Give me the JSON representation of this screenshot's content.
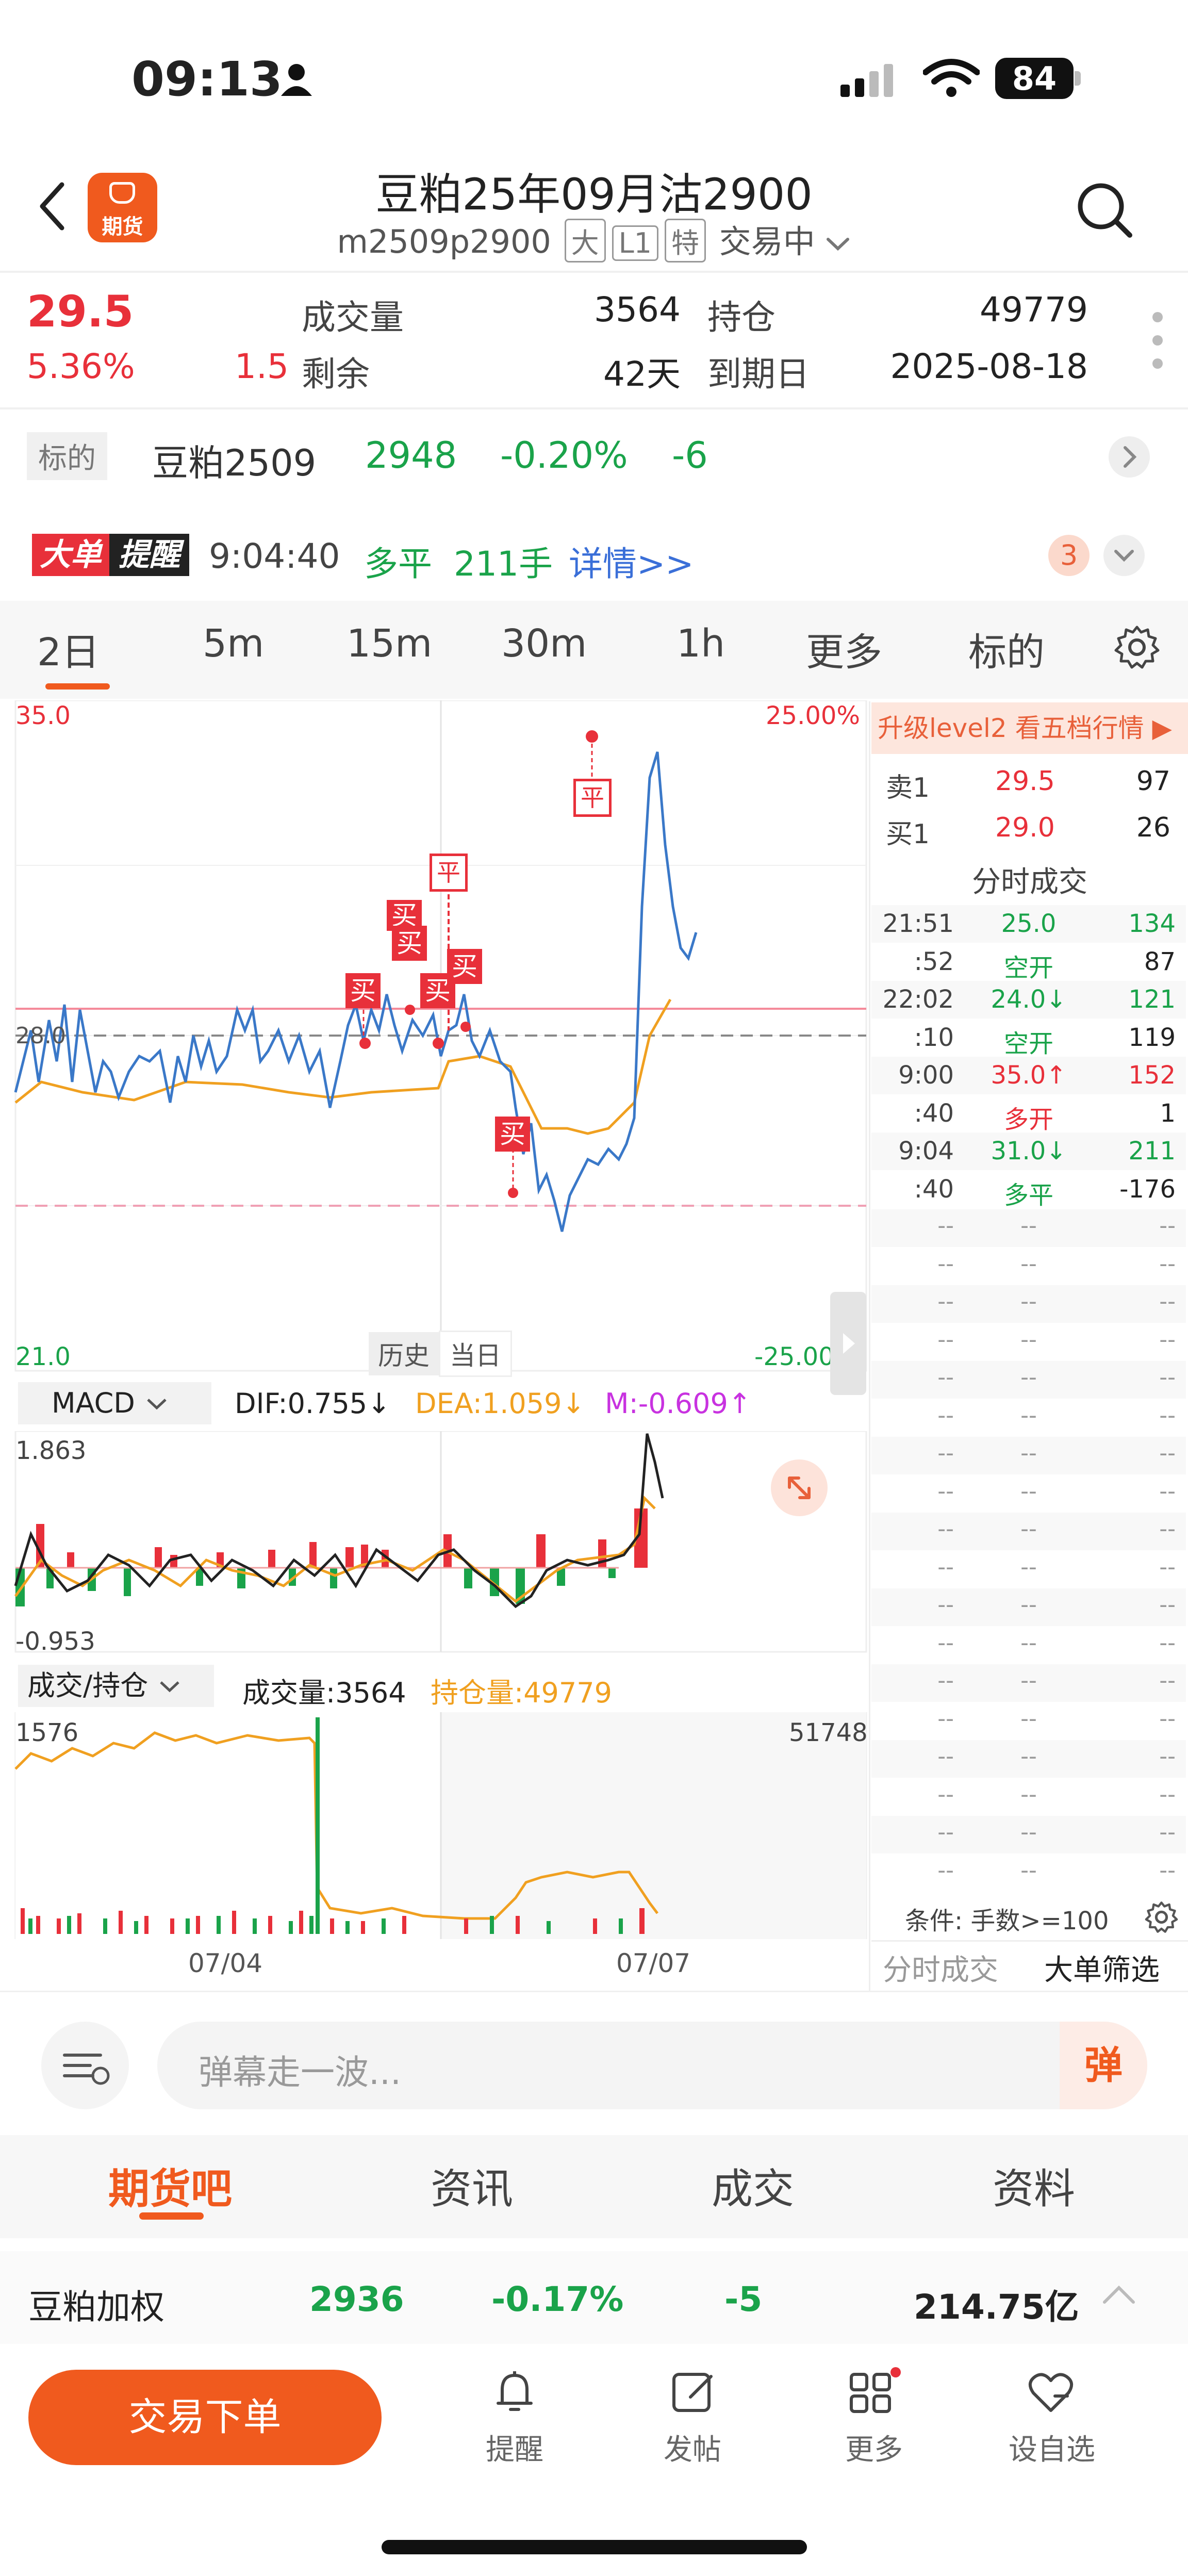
{
  "status": {
    "time": "09:13",
    "battery": "84"
  },
  "header": {
    "title": "豆粕25年09月沽2900",
    "logo_text": "期货",
    "contract": "m2509p2900",
    "tags": [
      "大",
      "L1",
      "特"
    ],
    "trading_status": "交易中"
  },
  "quote": {
    "price": "29.5",
    "change_pct": "5.36%",
    "change": "1.5",
    "volume_label": "成交量",
    "volume": "3564",
    "oi_label": "持仓",
    "oi": "49779",
    "remain_label": "剩余",
    "remain": "42天",
    "expiry_label": "到期日",
    "expiry": "2025-08-18"
  },
  "underlying": {
    "tag": "标的",
    "name": "豆粕2509",
    "price": "2948",
    "pct": "-0.20%",
    "chg": "-6"
  },
  "alert": {
    "badge1": "大单",
    "badge2": "提醒",
    "time": "9:04:40",
    "type": "多平",
    "size": "211手",
    "detail": "详情>>",
    "count": "3"
  },
  "chart_tabs": [
    "2日",
    "5m",
    "15m",
    "30m",
    "1h",
    "更多",
    "标的"
  ],
  "main_chart": {
    "y_top": "35.0",
    "y_bottom": "21.0",
    "y_mid": "28.0",
    "pct_top": "25.00%",
    "pct_bottom": "-25.00%",
    "history_btn": "历史",
    "today_btn": "当日",
    "markers": [
      "买",
      "买",
      "买",
      "买",
      "买",
      "平",
      "买",
      "平"
    ]
  },
  "macd": {
    "selector": "MACD",
    "dif": "DIF:0.755↓",
    "dea": "DEA:1.059↓",
    "m": "M:-0.609↑",
    "top": "1.863",
    "bottom": "-0.953"
  },
  "volume_chart": {
    "selector": "成交/持仓",
    "vol": "成交量:3564",
    "oi": "持仓量:49779",
    "left_top": "1576",
    "right_top": "51748",
    "date1": "07/04",
    "date2": "07/07"
  },
  "book": {
    "upgrade": "升级level2 看五档行情 ▶",
    "sell_label": "卖1",
    "sell_price": "29.5",
    "sell_vol": "97",
    "buy_label": "买1",
    "buy_price": "29.0",
    "buy_vol": "26",
    "ticks_title": "分时成交",
    "ticks": [
      {
        "t": "21:51",
        "p": "25.0",
        "v": "134",
        "pc": "green",
        "vc": "green"
      },
      {
        "t": ":52",
        "p": "空开",
        "v": "87",
        "pc": "green",
        "vc": "dark"
      },
      {
        "t": "22:02",
        "p": "24.0↓",
        "v": "121",
        "pc": "green",
        "vc": "green"
      },
      {
        "t": ":10",
        "p": "空开",
        "v": "119",
        "pc": "green",
        "vc": "dark"
      },
      {
        "t": "9:00",
        "p": "35.0↑",
        "v": "152",
        "pc": "red",
        "vc": "red"
      },
      {
        "t": ":40",
        "p": "多开",
        "v": "1",
        "pc": "red",
        "vc": "dark"
      },
      {
        "t": "9:04",
        "p": "31.0↓",
        "v": "211",
        "pc": "green",
        "vc": "green"
      },
      {
        "t": ":40",
        "p": "多平",
        "v": "-176",
        "pc": "green",
        "vc": "dark"
      }
    ],
    "empty": "--",
    "filter": "条件: 手数>=100",
    "tab1": "分时成交",
    "tab2": "大单筛选"
  },
  "comment": {
    "placeholder": "弹幕走一波...",
    "send": "弹"
  },
  "bottom_tabs": [
    "期货吧",
    "资讯",
    "成交",
    "资料"
  ],
  "index_bar": {
    "name": "豆粕加权",
    "price": "2936",
    "pct": "-0.17%",
    "chg": "-5",
    "amount": "214.75亿"
  },
  "nav": {
    "trade": "交易下单",
    "remind": "提醒",
    "post": "发帖",
    "more": "更多",
    "watch": "设自选"
  },
  "colors": {
    "red": "#e8303a",
    "green": "#1aa34a",
    "orange": "#f05a1e",
    "blue": "#3a6fd8"
  }
}
